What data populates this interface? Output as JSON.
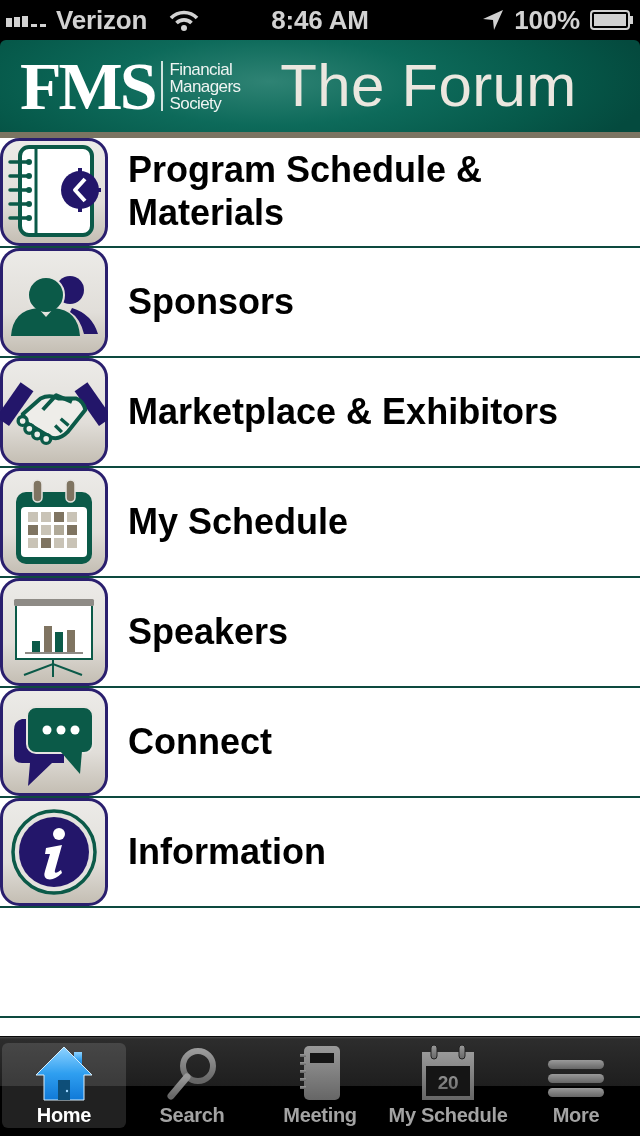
{
  "status_bar": {
    "carrier": "Verizon",
    "time": "8:46 AM",
    "battery": "100%"
  },
  "header": {
    "logo_mark": "FMS",
    "logo_tagline": [
      "Financial",
      "Managers",
      "Society"
    ],
    "title": "The Forum"
  },
  "menu": {
    "items": [
      {
        "label": "Program Schedule & Materials",
        "kind": "planner"
      },
      {
        "label": "Sponsors",
        "kind": "people"
      },
      {
        "label": "Marketplace & Exhibitors",
        "kind": "handshake"
      },
      {
        "label": "My Schedule",
        "kind": "calendar"
      },
      {
        "label": "Speakers",
        "kind": "presentation"
      },
      {
        "label": "Connect",
        "kind": "chat"
      },
      {
        "label": "Information",
        "kind": "info"
      }
    ]
  },
  "tab_bar": {
    "tabs": [
      {
        "label": "Home",
        "kind": "home",
        "selected": true
      },
      {
        "label": "Search",
        "kind": "search",
        "selected": false
      },
      {
        "label": "Meeting",
        "kind": "meeting",
        "selected": false
      },
      {
        "label": "My Schedule",
        "kind": "calendar",
        "selected": false,
        "icon_text": "20"
      },
      {
        "label": "More",
        "kind": "more",
        "selected": false
      }
    ]
  }
}
